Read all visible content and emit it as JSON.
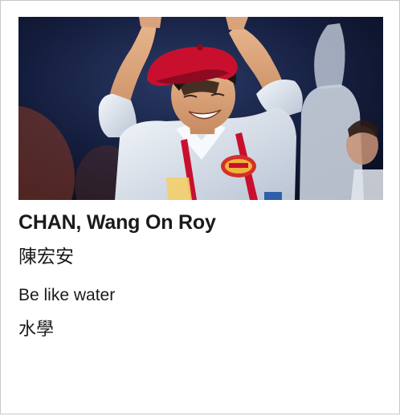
{
  "profile": {
    "photo_alt": "Performer in red beret and white chef jacket raising arms on stage",
    "name_en": "CHAN, Wang On Roy",
    "name_zh": "陳宏安",
    "motto_en": "Be like water",
    "motto_zh": "水學"
  },
  "colors": {
    "stage_background": "#0f1730",
    "beret": "#c8102e",
    "jacket": "#e9eef4",
    "card_border": "#c8c8c8",
    "text": "#1a1a1a"
  }
}
